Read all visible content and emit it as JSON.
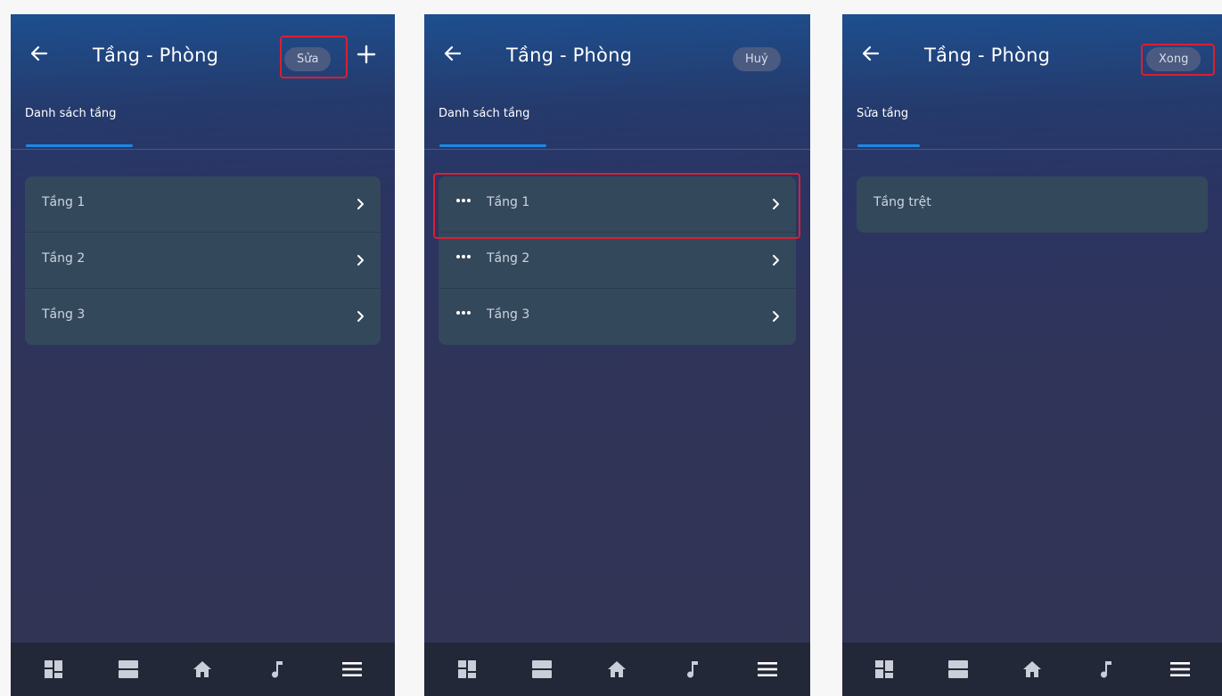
{
  "screens": [
    {
      "title": "Tầng - Phòng",
      "action_label": "Sửa",
      "tab_label": "Danh sách tầng",
      "floors": [
        "Tầng 1",
        "Tầng 2",
        "Tầng 3"
      ]
    },
    {
      "title": "Tầng - Phòng",
      "action_label": "Huỷ",
      "tab_label": "Danh sách tầng",
      "floors": [
        "Tầng 1",
        "Tầng 2",
        "Tầng 3"
      ]
    },
    {
      "title": "Tầng - Phòng",
      "action_label": "Xong",
      "tab_label": "Sửa tầng",
      "floors": [
        "Tầng trệt"
      ]
    }
  ],
  "icons": {
    "back": "arrow-left-icon",
    "add": "plus-icon",
    "more": "more-dots-icon",
    "chevron": "chevron-right-icon",
    "nav": [
      "dashboard-icon",
      "rooms-icon",
      "home-icon",
      "music-icon",
      "menu-icon"
    ]
  },
  "colors": {
    "highlight": "#dc1f2f",
    "tab_indicator": "#1e88e5",
    "row_background": "#34485c",
    "bottom_bar": "#232838"
  }
}
